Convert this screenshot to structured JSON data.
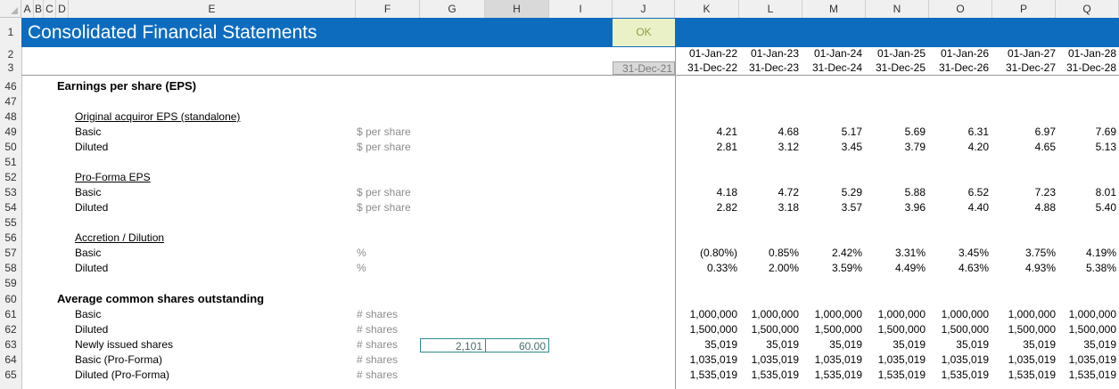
{
  "sheet": {
    "title": "Consolidated Financial Statements",
    "ok_label": "OK",
    "prev_period_end": "31-Dec-21",
    "columns": [
      "A",
      "B",
      "C",
      "D",
      "E",
      "F",
      "G",
      "H",
      "I",
      "J",
      "K",
      "L",
      "M",
      "N",
      "O",
      "P",
      "Q"
    ],
    "selected_column": "H",
    "row_numbers": [
      "1",
      "2",
      "3",
      "46",
      "47",
      "48",
      "49",
      "50",
      "51",
      "52",
      "53",
      "54",
      "55",
      "56",
      "57",
      "58",
      "59",
      "60",
      "61",
      "62",
      "63",
      "64",
      "65"
    ],
    "period_starts": [
      "01-Jan-22",
      "01-Jan-23",
      "01-Jan-24",
      "01-Jan-25",
      "01-Jan-26",
      "01-Jan-27",
      "01-Jan-28"
    ],
    "period_ends": [
      "31-Dec-22",
      "31-Dec-23",
      "31-Dec-24",
      "31-Dec-25",
      "31-Dec-26",
      "31-Dec-27",
      "31-Dec-28"
    ],
    "input_cells": {
      "g63": "2,101",
      "h63": "60.00"
    }
  },
  "rows": {
    "r46": {
      "label": "Earnings per share (EPS)"
    },
    "r48": {
      "label": "Original acquiror EPS (standalone)"
    },
    "r49": {
      "label": "Basic",
      "unit": "$ per share",
      "values": [
        "4.21",
        "4.68",
        "5.17",
        "5.69",
        "6.31",
        "6.97",
        "7.69"
      ]
    },
    "r50": {
      "label": "Diluted",
      "unit": "$ per share",
      "values": [
        "2.81",
        "3.12",
        "3.45",
        "3.79",
        "4.20",
        "4.65",
        "5.13"
      ]
    },
    "r52": {
      "label": "Pro-Forma EPS"
    },
    "r53": {
      "label": "Basic",
      "unit": "$ per share",
      "values": [
        "4.18",
        "4.72",
        "5.29",
        "5.88",
        "6.52",
        "7.23",
        "8.01"
      ]
    },
    "r54": {
      "label": "Diluted",
      "unit": "$ per share",
      "values": [
        "2.82",
        "3.18",
        "3.57",
        "3.96",
        "4.40",
        "4.88",
        "5.40"
      ]
    },
    "r56": {
      "label": "Accretion / Dilution"
    },
    "r57": {
      "label": "Basic",
      "unit": "%",
      "values": [
        "(0.80%)",
        "0.85%",
        "2.42%",
        "3.31%",
        "3.45%",
        "3.75%",
        "4.19%"
      ]
    },
    "r58": {
      "label": "Diluted",
      "unit": "%",
      "values": [
        "0.33%",
        "2.00%",
        "3.59%",
        "4.49%",
        "4.63%",
        "4.93%",
        "5.38%"
      ]
    },
    "r60": {
      "label": "Average common shares outstanding"
    },
    "r61": {
      "label": "Basic",
      "unit": "# shares",
      "values": [
        "1,000,000",
        "1,000,000",
        "1,000,000",
        "1,000,000",
        "1,000,000",
        "1,000,000",
        "1,000,000"
      ]
    },
    "r62": {
      "label": "Diluted",
      "unit": "# shares",
      "values": [
        "1,500,000",
        "1,500,000",
        "1,500,000",
        "1,500,000",
        "1,500,000",
        "1,500,000",
        "1,500,000"
      ]
    },
    "r63": {
      "label": "Newly issued shares",
      "unit": "# shares",
      "values": [
        "35,019",
        "35,019",
        "35,019",
        "35,019",
        "35,019",
        "35,019",
        "35,019"
      ]
    },
    "r64": {
      "label": "Basic (Pro-Forma)",
      "unit": "# shares",
      "values": [
        "1,035,019",
        "1,035,019",
        "1,035,019",
        "1,035,019",
        "1,035,019",
        "1,035,019",
        "1,035,019"
      ]
    },
    "r65": {
      "label": "Diluted (Pro-Forma)",
      "unit": "# shares",
      "values": [
        "1,535,019",
        "1,535,019",
        "1,535,019",
        "1,535,019",
        "1,535,019",
        "1,535,019",
        "1,535,019"
      ]
    }
  }
}
